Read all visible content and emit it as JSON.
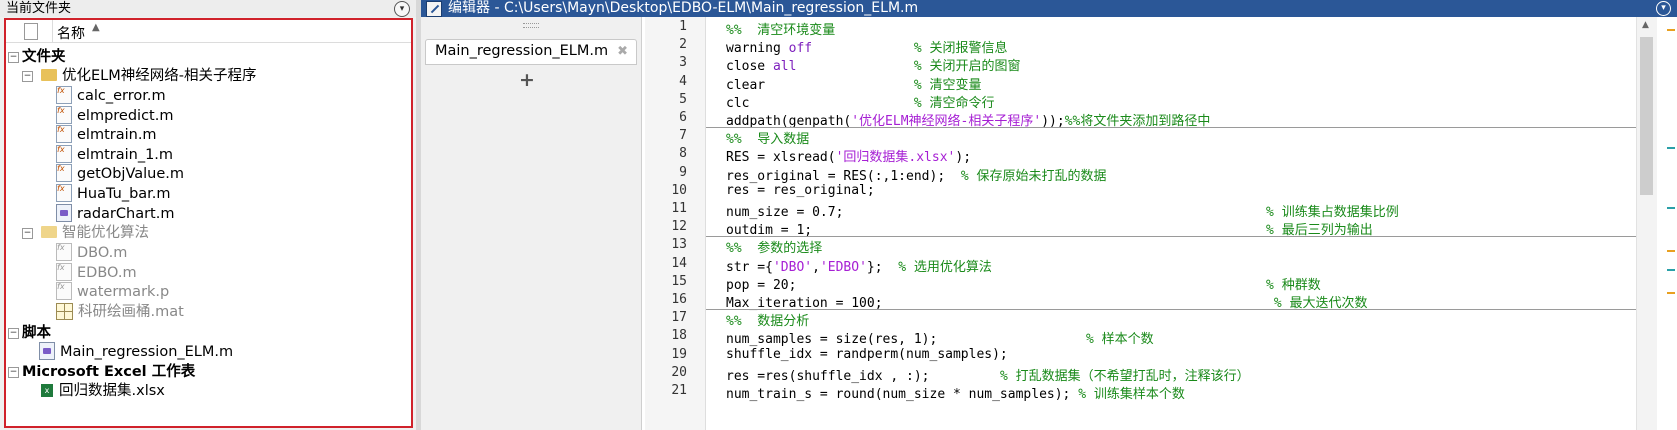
{
  "left_panel": {
    "title": "当前文件夹",
    "column_header": "名称",
    "groups": [
      {
        "label": "文件夹"
      },
      {
        "label": "脚本"
      },
      {
        "label": "Microsoft Excel 工作表"
      }
    ],
    "folders": [
      {
        "name": "优化ELM神经网络-相关子程序",
        "files": [
          "calc_error.m",
          "elmpredict.m",
          "elmtrain.m",
          "elmtrain_1.m",
          "getObjValue.m",
          "HuaTu_bar.m",
          "radarChart.m"
        ]
      },
      {
        "name": "智能优化算法",
        "files": [
          "DBO.m",
          "EDBO.m",
          "watermark.p",
          "科研绘画桶.mat"
        ]
      }
    ],
    "scripts": [
      "Main_regression_ELM.m"
    ],
    "excel": [
      "回归数据集.xlsx"
    ],
    "selection_box_color": "#d0222b"
  },
  "editor": {
    "title": "编辑器 - C:\\Users\\Mayn\\Desktop\\EDBO-ELM\\Main_regression_ELM.m",
    "tab_label": "Main_regression_ELM.m",
    "add_tab": "+",
    "title_bar_color": "#2b5797",
    "code_lines": [
      {
        "n": "1",
        "text": "%%  清空环境变量"
      },
      {
        "n": "2",
        "text": "warning off             % 关闭报警信息"
      },
      {
        "n": "3",
        "text": "close all               % 关闭开启的图窗"
      },
      {
        "n": "4",
        "text": "clear                   % 清空变量"
      },
      {
        "n": "5",
        "text": "clc                     % 清空命令行"
      },
      {
        "n": "6",
        "text": "addpath(genpath('优化ELM神经网络-相关子程序'));%%将文件夹添加到路径中"
      },
      {
        "n": "7",
        "text": "%%  导入数据"
      },
      {
        "n": "8",
        "text": "RES = xlsread('回归数据集.xlsx');"
      },
      {
        "n": "9",
        "text": "res_original = RES(:,1:end);  % 保存原始未打乱的数据"
      },
      {
        "n": "10",
        "text": "res = res_original;"
      },
      {
        "n": "11",
        "text": "num_size = 0.7;                                                      % 训练集占数据集比例"
      },
      {
        "n": "12",
        "text": "outdim = 1;                                                          % 最后三列为输出"
      },
      {
        "n": "13",
        "text": "%%  参数的选择"
      },
      {
        "n": "14",
        "text": "str ={'DBO','EDBO'};  % 选用优化算法"
      },
      {
        "n": "15",
        "text": "pop = 20;                                                            % 种群数"
      },
      {
        "n": "16",
        "text": "Max_iteration = 100;                                                  % 最大迭代次数"
      },
      {
        "n": "17",
        "text": "%%  数据分析"
      },
      {
        "n": "18",
        "text": "num_samples = size(res, 1);                   % 样本个数"
      },
      {
        "n": "19",
        "text": "shuffle_idx = randperm(num_samples);"
      },
      {
        "n": "20",
        "text": "res =res(shuffle_idx , :);         % 打乱数据集（不希望打乱时，注释该行）"
      },
      {
        "n": "21",
        "text": "num_train_s = round(num_size * num_samples); % 训练集样本个数"
      }
    ]
  }
}
